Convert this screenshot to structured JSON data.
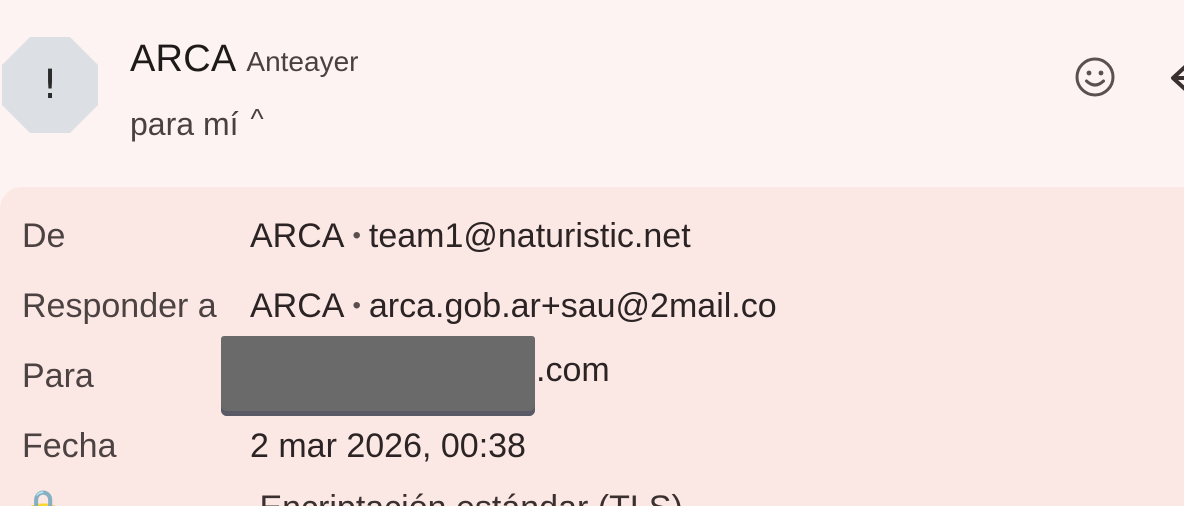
{
  "header": {
    "avatar_glyph": "!",
    "sender_name": "ARCA",
    "date": "Anteayer",
    "recipient_label": "para mí",
    "caret": "^",
    "icons": [
      "emoji-icon",
      "reply-icon"
    ]
  },
  "details": {
    "from_label": "De",
    "from_name": "ARCA",
    "from_email": "team1@naturistic.net",
    "reply_label": "Responder a",
    "reply_name": "ARCA",
    "reply_email": "arca.gob.ar+sau@2mail.co",
    "to_label": "Para",
    "to_suffix": ".com",
    "date_label": "Fecha",
    "date_value": "2 mar 2026, 00:38",
    "partial_row": "Encriptación estándar (TLS)"
  },
  "colors": {
    "background": "#fdf3f2",
    "panel": "#fbe8e5",
    "avatar": "#dcdfe3",
    "redaction": "#6a6a6a"
  }
}
